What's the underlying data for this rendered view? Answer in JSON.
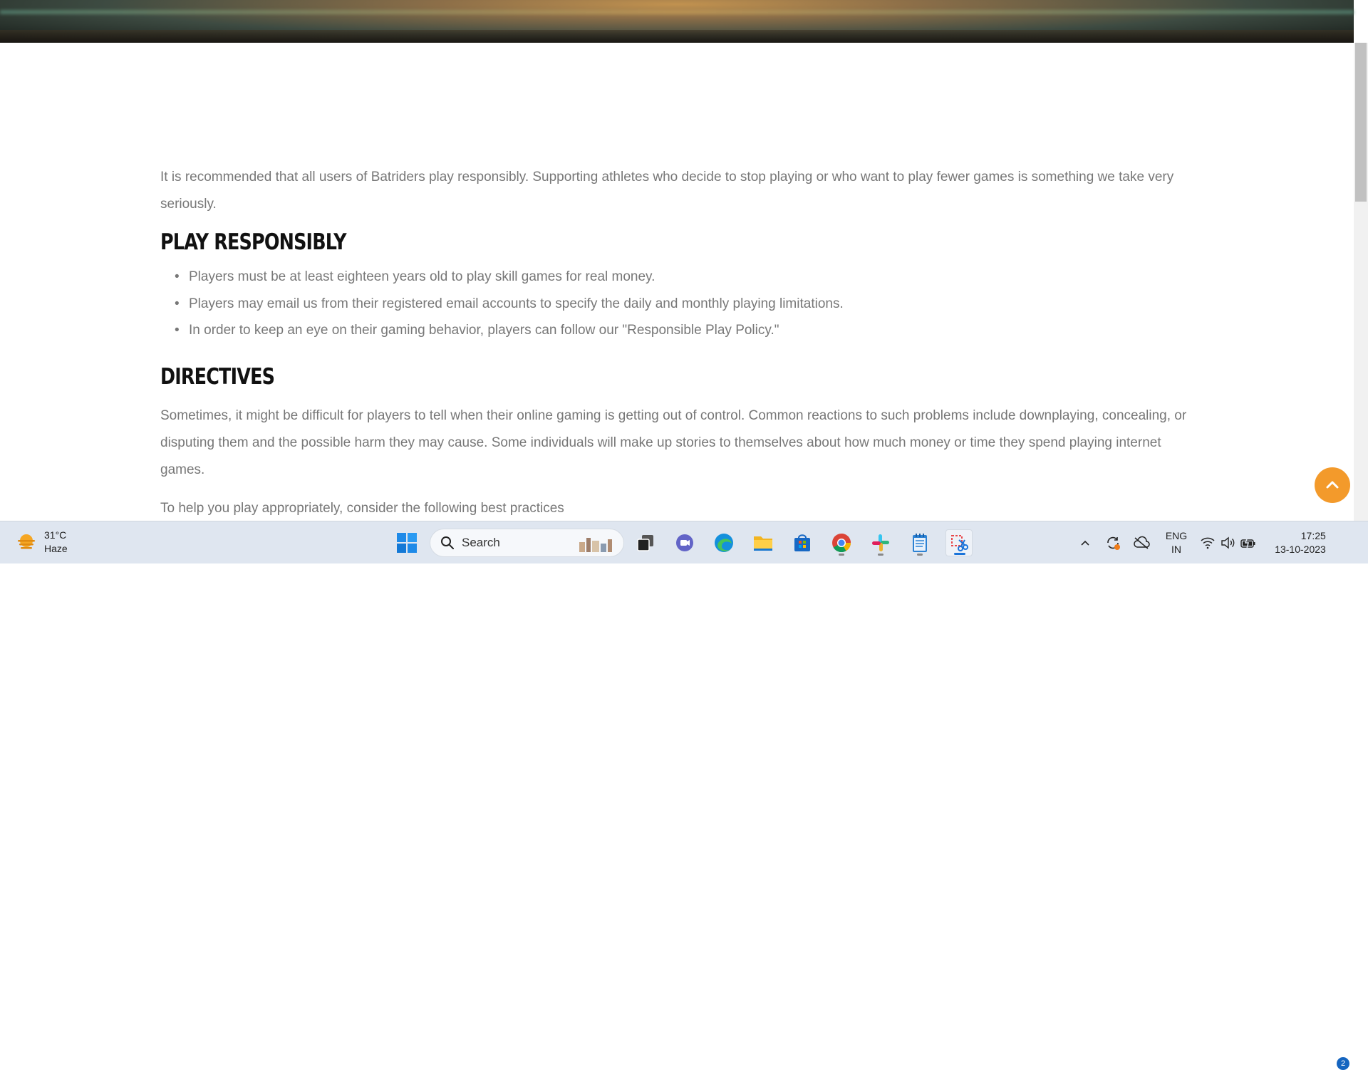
{
  "article": {
    "intro": "It is recommended that all users of Batriders play responsibly. Supporting athletes who decide to stop playing or who want to play fewer games is something we take very seriously.",
    "section1_title": "PLAY RESPONSIBLY",
    "rules": [
      "Players must be at least eighteen years old to play skill games for real money.",
      "Players may email us from their registered email accounts to specify the daily and monthly playing limitations.",
      "In order to keep an eye on their gaming behavior, players can follow our \"Responsible Play Policy.\""
    ],
    "section2_title": "DIRECTIVES",
    "directives_text": "Sometimes, it might be difficult for players to tell when their online gaming is getting out of control. Common reactions to such problems include downplaying, concealing, or disputing them and the possible harm they may cause. Some individuals will make up stories to themselves about how much money or time they spend playing internet games.",
    "partial_text": "To help you play appropriately, consider the following best practices"
  },
  "taskbar": {
    "weather_temp": "31°C",
    "weather_desc": "Haze",
    "search_label": "Search",
    "lang_top": "ENG",
    "lang_bottom": "IN",
    "time": "17:25",
    "date": "13-10-2023",
    "notification_count": "2"
  },
  "colors": {
    "accent": "#f39a2b",
    "body_text": "#777777",
    "heading": "#111111"
  }
}
